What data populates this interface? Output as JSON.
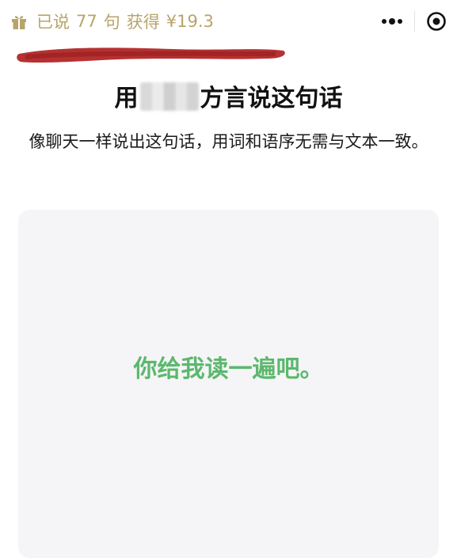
{
  "header": {
    "earn_prefix": "已说",
    "count": "77",
    "unit": "句",
    "earn_label": "获得",
    "amount": "¥19.3",
    "gift_icon": "gift-icon",
    "more_icon": "more-dots-icon",
    "close_icon": "target-close-icon"
  },
  "task": {
    "title_prefix": "用",
    "title_suffix": "方言说这句话",
    "instruction": "像聊天一样说出这句话，用词和语序无需与文本一致。"
  },
  "card": {
    "prompt": "你给我读一遍吧。"
  },
  "colors": {
    "gold": "#b8a46a",
    "green": "#5cb86d",
    "card_bg": "#f5f5f7",
    "redaction": "#b0201f"
  }
}
